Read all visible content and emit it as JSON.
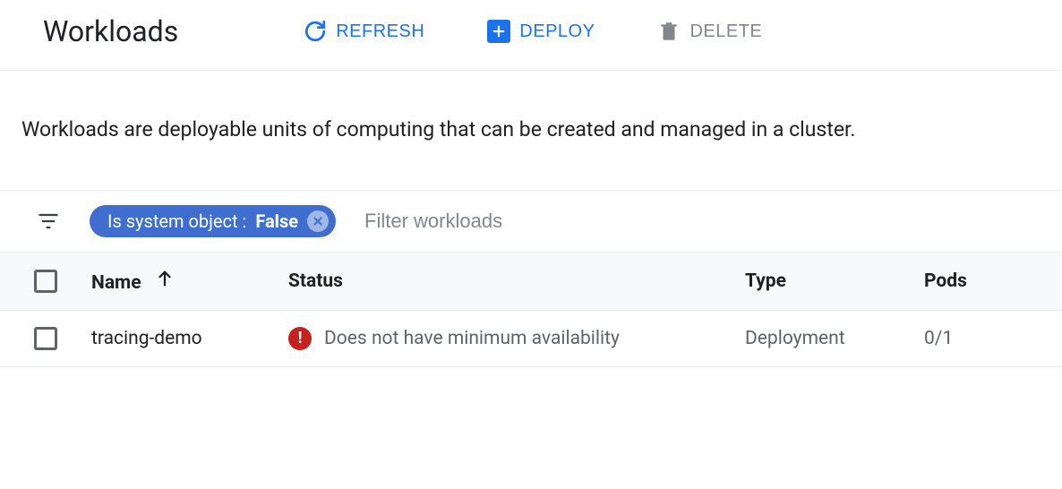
{
  "header": {
    "title": "Workloads",
    "refresh_label": "REFRESH",
    "deploy_label": "DEPLOY",
    "delete_label": "DELETE"
  },
  "description": "Workloads are deployable units of computing that can be created and managed in a cluster.",
  "filter": {
    "chip_key": "Is system object : ",
    "chip_value": "False",
    "placeholder": "Filter workloads"
  },
  "table": {
    "columns": {
      "name": "Name",
      "status": "Status",
      "type": "Type",
      "pods": "Pods"
    },
    "rows": [
      {
        "name": "tracing-demo",
        "status": "Does not have minimum availability",
        "status_kind": "error",
        "type": "Deployment",
        "pods": "0/1"
      }
    ]
  },
  "colors": {
    "blue": "#1a73e8",
    "gray_text": "#5f6368",
    "error": "#c5221f",
    "chip_bg": "#3f6ecf"
  }
}
